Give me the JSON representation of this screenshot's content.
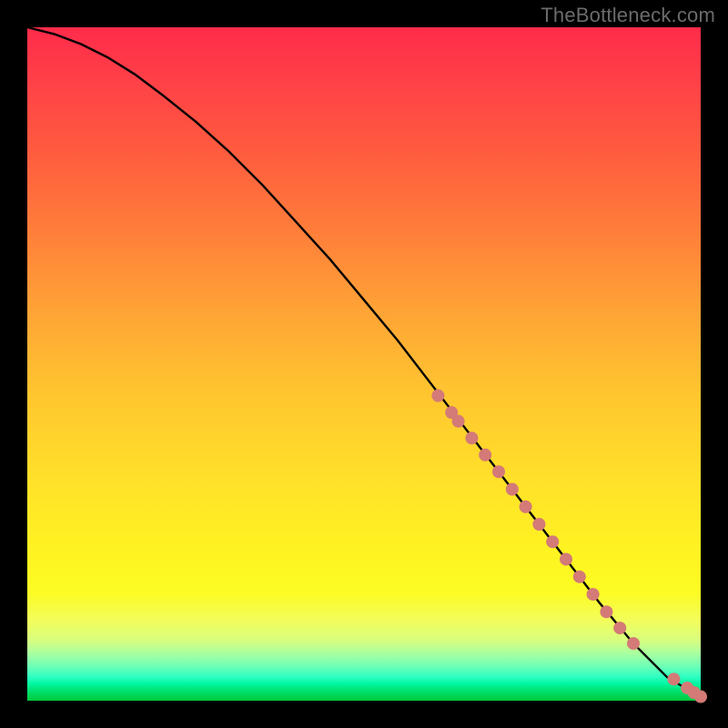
{
  "attribution": "TheBottleneck.com",
  "chart_data": {
    "type": "line",
    "title": "",
    "xlabel": "",
    "ylabel": "",
    "xlim": [
      0,
      100
    ],
    "ylim": [
      0,
      100
    ],
    "grid": false,
    "legend": false,
    "series": [
      {
        "name": "curve",
        "type": "line",
        "x": [
          0,
          4,
          8,
          12,
          16,
          20,
          25,
          30,
          35,
          40,
          45,
          50,
          55,
          60,
          65,
          70,
          75,
          80,
          85,
          90,
          95,
          100
        ],
        "y": [
          100,
          99,
          97.5,
          95.5,
          93,
          90,
          86,
          81.5,
          76.5,
          71,
          65.5,
          59.5,
          53.5,
          47,
          40.5,
          34,
          27.5,
          21,
          14.5,
          8.5,
          3.5,
          0.5
        ]
      },
      {
        "name": "points-on-curve",
        "type": "scatter",
        "color": "#d47a77",
        "x": [
          61,
          63,
          64,
          66,
          68,
          70,
          72,
          74,
          76,
          78,
          80,
          82,
          84,
          86,
          88,
          90,
          96,
          98,
          99,
          100
        ],
        "y": [
          45.3,
          42.8,
          41.5,
          39,
          36.5,
          34,
          31.4,
          28.8,
          26.2,
          23.6,
          21,
          18.4,
          15.8,
          13.2,
          10.8,
          8.5,
          3.2,
          1.9,
          1.2,
          0.6
        ]
      }
    ]
  }
}
